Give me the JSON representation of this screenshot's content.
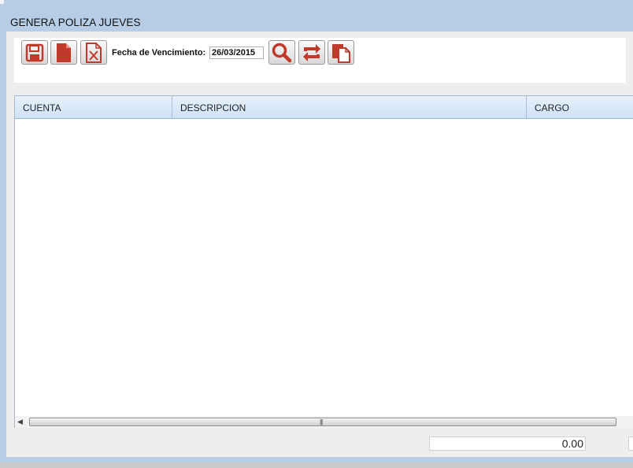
{
  "window": {
    "title": "GENERA POLIZA JUEVES"
  },
  "toolbar": {
    "buttons": [
      {
        "icon": "floppy-disk-icon",
        "name": "save-button"
      },
      {
        "icon": "document-icon",
        "name": "new-document-button"
      },
      {
        "icon": "excel-icon",
        "name": "export-excel-button"
      },
      {
        "icon": "search-icon",
        "name": "search-button"
      },
      {
        "icon": "refresh-icon",
        "name": "refresh-button"
      },
      {
        "icon": "copy-icon",
        "name": "copy-button"
      }
    ],
    "date_label": "Fecha de Vencimiento:",
    "date_value": "26/03/2015"
  },
  "grid": {
    "columns": [
      "CUENTA",
      "DESCRIPCION",
      "CARGO"
    ],
    "rows": []
  },
  "totals": {
    "cargo_total": "0.00"
  },
  "colors": {
    "accent": "#c0392b",
    "frame": "#b7cde6",
    "header": "#d6e7fb"
  }
}
